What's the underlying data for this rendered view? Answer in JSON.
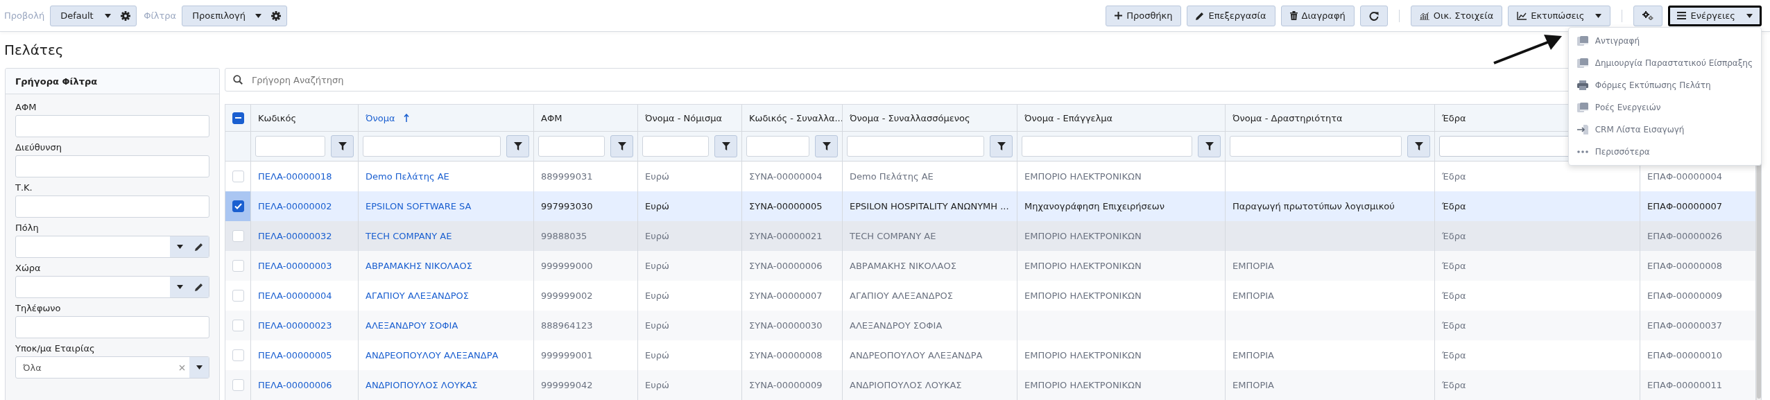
{
  "toolbar": {
    "view_label": "Προβολή",
    "view_value": "Default",
    "filter_label": "Φίλτρα",
    "filter_value": "Προεπιλογή",
    "buttons": [
      {
        "kind": "text",
        "label": "Προσθήκη"
      },
      {
        "kind": "text",
        "label": "Επεξεργασία"
      },
      {
        "kind": "text",
        "label": "Διαγραφή"
      },
      {
        "kind": "icon"
      },
      {
        "kind": "separator"
      },
      {
        "kind": "text",
        "label": "Οικ. Στοιχεία"
      },
      {
        "kind": "dropdown",
        "label": "Εκτυπώσεις",
        "open": false
      },
      {
        "kind": "separator"
      },
      {
        "kind": "icon"
      },
      {
        "kind": "dropdown",
        "label": "Ενέργειες",
        "open": true
      }
    ]
  },
  "page_title": "Πελάτες",
  "quick_filters": {
    "title": "Γρήγορα Φίλτρα",
    "fields": [
      {
        "label": "ΑΦΜ",
        "kind": "text"
      },
      {
        "label": "Διεύθυνση",
        "kind": "text"
      },
      {
        "label": "Τ.Κ.",
        "kind": "text"
      },
      {
        "label": "Πόλη",
        "kind": "lookup"
      },
      {
        "label": "Χώρα",
        "kind": "lookup"
      },
      {
        "label": "Τηλέφωνο",
        "kind": "text"
      },
      {
        "label": "Υποκ/μα Εταιρίας",
        "kind": "select",
        "value": "Όλα"
      }
    ]
  },
  "search": {
    "placeholder": "Γρήγορη Αναζήτηση"
  },
  "table": {
    "select_all": {
      "indeterminate": true
    },
    "columns": [
      {
        "label": "Κωδικός",
        "sorted": false,
        "kind": "link",
        "filter_button": true
      },
      {
        "label": "Όνομα",
        "sorted": true,
        "kind": "link",
        "filter_button": true
      },
      {
        "label": "ΑΦΜ",
        "sorted": false,
        "kind": "text",
        "filter_button": true
      },
      {
        "label": "Όνομα - Νόμισμα",
        "sorted": false,
        "kind": "text",
        "filter_button": true
      },
      {
        "label": "Κωδικός - Συναλλα...",
        "sorted": false,
        "kind": "text",
        "filter_button": true
      },
      {
        "label": "Όνομα - Συναλλασσόμενος",
        "sorted": false,
        "kind": "text",
        "filter_button": true
      },
      {
        "label": "Όνομα - Επάγγελμα",
        "sorted": false,
        "kind": "text",
        "filter_button": true
      },
      {
        "label": "Όνομα - Δραστηριότητα",
        "sorted": false,
        "kind": "text",
        "filter_button": true
      },
      {
        "label": "Έδρα",
        "sorted": false,
        "kind": "text",
        "filter_button": false
      },
      {
        "kind": "text"
      }
    ],
    "rows": [
      {
        "selected": false,
        "hovered": false,
        "cells": [
          "ΠΕΛΑ-00000018",
          "Demo Πελάτης ΑΕ",
          "889999031",
          "Ευρώ",
          "ΣΥΝΑ-00000004",
          "Demo Πελάτης ΑΕ",
          "ΕΜΠΟΡΙΟ ΗΛΕΚΤΡΟΝΙΚΩΝ",
          null,
          "Έδρα",
          "ΕΠΑΦ-00000004"
        ]
      },
      {
        "selected": true,
        "hovered": false,
        "cells": [
          "ΠΕΛΑ-00000002",
          "EPSILON SOFTWARE SA",
          "997993030",
          "Ευρώ",
          "ΣΥΝΑ-00000005",
          "EPSILON HOSPITALITY ΑΝΩΝΥΜΗ ...",
          "Μηχανογράφηση Επιχειρήσεων",
          "Παραγωγή πρωτοτύπων λογισμικού",
          "Έδρα",
          "ΕΠΑΦ-00000007"
        ]
      },
      {
        "selected": false,
        "hovered": true,
        "cells": [
          "ΠΕΛΑ-00000032",
          "TECH COMPANY AE",
          "99888035",
          "Ευρώ",
          "ΣΥΝΑ-00000021",
          "TECH COMPANY AE",
          "ΕΜΠΟΡΙΟ ΗΛΕΚΤΡΟΝΙΚΩΝ",
          null,
          "Έδρα",
          "ΕΠΑΦ-00000026"
        ]
      },
      {
        "selected": false,
        "hovered": false,
        "cells": [
          "ΠΕΛΑ-00000003",
          "ΑΒΡΑΜΑΚΗΣ ΝΙΚΟΛΑΟΣ",
          "999999000",
          "Ευρώ",
          "ΣΥΝΑ-00000006",
          "ΑΒΡΑΜΑΚΗΣ ΝΙΚΟΛΑΟΣ",
          "ΕΜΠΟΡΙΟ ΗΛΕΚΤΡΟΝΙΚΩΝ",
          "ΕΜΠΟΡΙΑ",
          "Έδρα",
          "ΕΠΑΦ-00000008"
        ]
      },
      {
        "selected": false,
        "hovered": false,
        "cells": [
          "ΠΕΛΑ-00000004",
          "ΑΓΑΠΙΟΥ ΑΛΕΞΑΝΔΡΟΣ",
          "999999002",
          "Ευρώ",
          "ΣΥΝΑ-00000007",
          "ΑΓΑΠΙΟΥ ΑΛΕΞΑΝΔΡΟΣ",
          "ΕΜΠΟΡΙΟ ΗΛΕΚΤΡΟΝΙΚΩΝ",
          "ΕΜΠΟΡΙΑ",
          "Έδρα",
          "ΕΠΑΦ-00000009"
        ]
      },
      {
        "selected": false,
        "hovered": false,
        "cells": [
          "ΠΕΛΑ-00000023",
          "ΑΛΕΞΑΝΔΡΟΥ ΣΟΦΙΑ",
          "888964123",
          "Ευρώ",
          "ΣΥΝΑ-00000030",
          "ΑΛΕΞΑΝΔΡΟΥ ΣΟΦΙΑ",
          null,
          null,
          "Έδρα",
          "ΕΠΑΦ-00000037"
        ]
      },
      {
        "selected": false,
        "hovered": false,
        "cells": [
          "ΠΕΛΑ-00000005",
          "ΑΝΔΡΕΟΠΟΥΛΟΥ ΑΛΕΞΑΝΔΡΑ",
          "999999001",
          "Ευρώ",
          "ΣΥΝΑ-00000008",
          "ΑΝΔΡΕΟΠΟΥΛΟΥ ΑΛΕΞΑΝΔΡΑ",
          "ΕΜΠΟΡΙΟ ΗΛΕΚΤΡΟΝΙΚΩΝ",
          "ΕΜΠΟΡΙΑ",
          "Έδρα",
          "ΕΠΑΦ-00000010"
        ]
      },
      {
        "selected": false,
        "hovered": false,
        "cells": [
          "ΠΕΛΑ-00000006",
          "ΑΝΔΡΙΟΠΟΥΛΟΣ ΛΟΥΚΑΣ",
          "999999042",
          "Ευρώ",
          "ΣΥΝΑ-00000009",
          "ΑΝΔΡΙΟΠΟΥΛΟΣ ΛΟΥΚΑΣ",
          "ΕΜΠΟΡΙΟ ΗΛΕΚΤΡΟΝΙΚΩΝ",
          "ΕΜΠΟΡΙΑ",
          "Έδρα",
          "ΕΠΑΦ-00000011"
        ]
      }
    ]
  },
  "actions_menu": {
    "items": [
      {
        "label": "Αντιγραφή",
        "kind": "document"
      },
      {
        "label": "Δημιουργία Παραστατικού Είσπραξης",
        "kind": "document"
      },
      {
        "label": "Φόρμες Εκτύπωσης Πελάτη",
        "kind": "print"
      },
      {
        "label": "Ροές Ενεργειών",
        "kind": "document"
      },
      {
        "label": "CRM Λίστα Εισαγωγή",
        "kind": "import"
      },
      {
        "label": "Περισσότερα",
        "kind": "more"
      }
    ]
  }
}
